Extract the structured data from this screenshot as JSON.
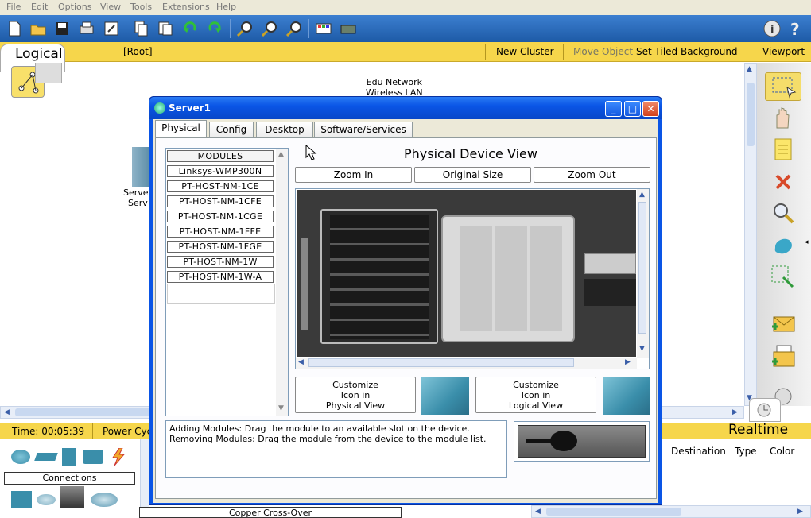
{
  "menu": [
    "File",
    "Edit",
    "Options",
    "View",
    "Tools",
    "Extensions",
    "Help"
  ],
  "toolbar_icons": [
    "new-file-icon",
    "open-folder-icon",
    "save-icon",
    "print-icon",
    "activity-wizard-icon",
    "copy-icon",
    "paste-icon",
    "undo-icon",
    "redo-icon",
    "zoom-in-icon",
    "zoom-reset-icon",
    "zoom-out-icon",
    "palette-icon",
    "device-template-icon",
    "info-icon",
    "help-icon"
  ],
  "workspace_bar": {
    "mode_tab": "Logical",
    "root": "[Root]",
    "new_cluster": "New Cluster",
    "move_object": "Move Object",
    "set_tiled_background": "Set Tiled Background",
    "viewport": "Viewport"
  },
  "canvas": {
    "edu_network_label_1": "Edu Network",
    "edu_network_label_2": "Wireless LAN",
    "server_label_1": "Serve",
    "server_label_2": "Serv"
  },
  "bottom": {
    "time": "Time: 00:05:39",
    "power_cycle": "Power Cyc",
    "realtime": "Realtime",
    "connections": "Connections",
    "cable_name": "Copper Cross-Over",
    "pdu_columns": [
      "Destination",
      "Type",
      "Color"
    ]
  },
  "dialog": {
    "title": "Server1",
    "tabs": [
      "Physical",
      "Config",
      "Desktop",
      "Software/Services"
    ],
    "active_tab": "Physical",
    "modules_header": "MODULES",
    "modules": [
      "Linksys-WMP300N",
      "PT-HOST-NM-1CE",
      "PT-HOST-NM-1CFE",
      "PT-HOST-NM-1CGE",
      "PT-HOST-NM-1FFE",
      "PT-HOST-NM-1FGE",
      "PT-HOST-NM-1W",
      "PT-HOST-NM-1W-A"
    ],
    "view_title": "Physical Device View",
    "zoom_in": "Zoom In",
    "original_size": "Original Size",
    "zoom_out": "Zoom Out",
    "customize_physical": [
      "Customize",
      "Icon in",
      "Physical View"
    ],
    "customize_logical": [
      "Customize",
      "Icon in",
      "Logical View"
    ],
    "help_line_1": "Adding Modules: Drag the module to an available slot on the device.",
    "help_line_2": "Removing Modules: Drag the module from the device to the module list."
  },
  "colors": {
    "toolbar_blue": "#1d5aa6",
    "workspace_bar_yellow": "#f6d64b",
    "dialog_title_blue": "#0a55e6",
    "close_red": "#e0502c"
  }
}
